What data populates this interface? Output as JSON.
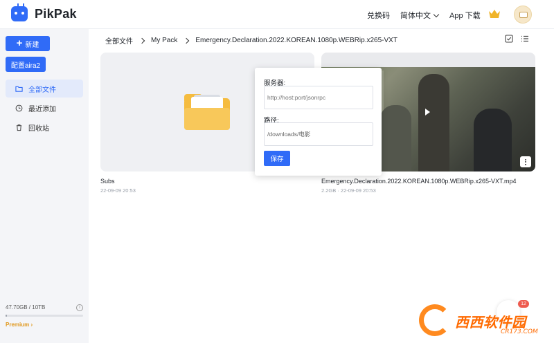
{
  "app": {
    "name": "PikPak"
  },
  "header": {
    "redeem": "兑换码",
    "language": "简体中文",
    "app_download": "App 下载"
  },
  "sidebar": {
    "new_button": "新建",
    "aria_button": "配置aira2",
    "items": [
      {
        "label": "全部文件",
        "icon": "folder-icon",
        "active": true
      },
      {
        "label": "最近添加",
        "icon": "clock-icon",
        "active": false
      },
      {
        "label": "回收站",
        "icon": "trash-icon",
        "active": false
      }
    ],
    "storage": {
      "text": "47.70GB / 10TB",
      "used_fraction": 0.00466
    },
    "premium": "Premium"
  },
  "breadcrumb": [
    "全部文件",
    "My Pack",
    "Emergency.Declaration.2022.KOREAN.1080p.WEBRip.x265-VXT"
  ],
  "files": [
    {
      "name": "Subs",
      "meta": "22-09-09 20:53",
      "type": "folder"
    },
    {
      "name": "Emergency.Declaration.2022.KOREAN.1080p.WEBRip.x265-VXT.mp4",
      "meta": "2.2GB · 22-09-09 20:53",
      "type": "video"
    }
  ],
  "popover": {
    "server_label": "服务器:",
    "server_placeholder": "http://host:port/jsonrpc",
    "path_label": "路径:",
    "path_value": "/downloads/电影",
    "save": "保存"
  },
  "help_badge": "12",
  "watermark": {
    "text": "西西软件园",
    "sub": "CR173.COM"
  },
  "colors": {
    "accent": "#306bf7",
    "folder": "#f5bc3f",
    "premium": "#e0981c"
  }
}
